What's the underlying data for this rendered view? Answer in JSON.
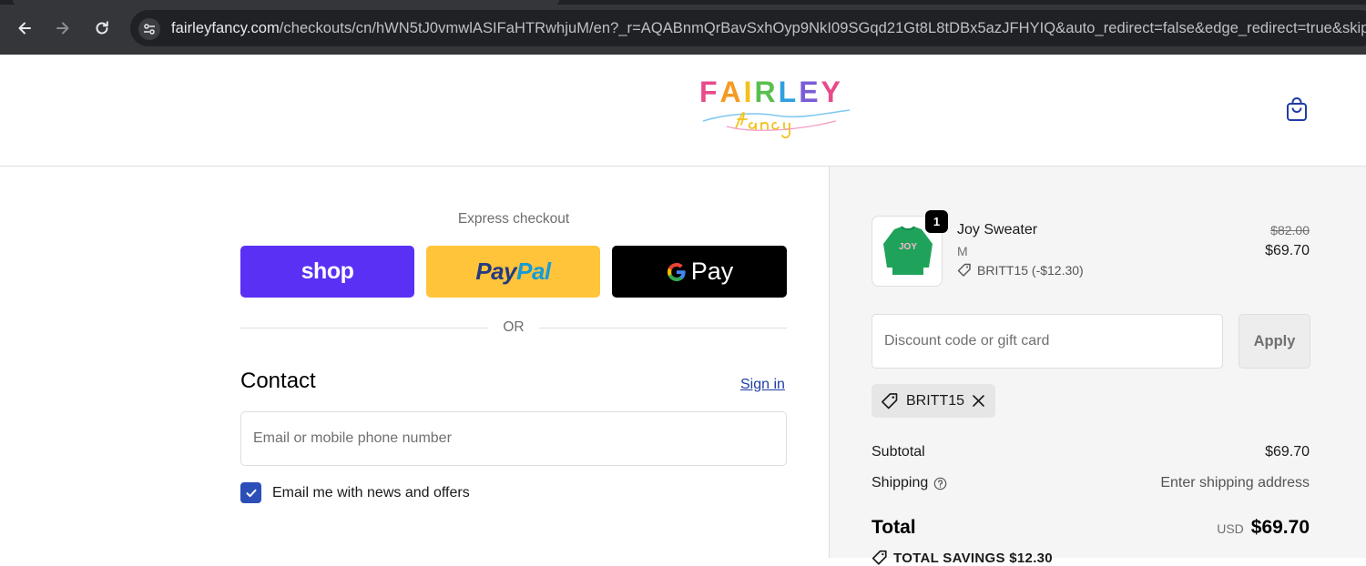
{
  "browser": {
    "url_host": "fairleyfancy.com",
    "url_path": "/checkouts/cn/hWN5tJ0vmwlASIFaHTRwhjuM/en?_r=AQABnmQrBavSxhOyp9NkI09SGqd21Gt8L8tDBx5azJFHYIQ&auto_redirect=false&edge_redirect=true&skip_s"
  },
  "store": {
    "logo_word": "FAIRLEY",
    "logo_script": "fancy",
    "logo_letter_colors": [
      "#e84a8a",
      "#f59a23",
      "#f2c21b",
      "#5bbf4f",
      "#2f9fe0",
      "#7a5cd6",
      "#e84a8a"
    ]
  },
  "express": {
    "label": "Express checkout",
    "shop_label": "shop",
    "paypal_label_1": "Pay",
    "paypal_label_2": "Pal",
    "gpay_label": "Pay"
  },
  "divider": {
    "label": "OR"
  },
  "contact": {
    "title": "Contact",
    "sign_in": "Sign in",
    "email_placeholder": "Email or mobile phone number",
    "news_label": "Email me with news and offers",
    "news_checked": true
  },
  "order": {
    "item": {
      "name": "Joy Sweater",
      "variant": "M",
      "quantity": "1",
      "discount": "BRITT15 (-$12.30)",
      "original_price": "$82.00",
      "price": "$69.70",
      "thumb_text": "JOY"
    },
    "discount_placeholder": "Discount code or gift card",
    "apply_label": "Apply",
    "applied_code": "BRITT15",
    "subtotal_label": "Subtotal",
    "subtotal_value": "$69.70",
    "shipping_label": "Shipping",
    "shipping_value": "Enter shipping address",
    "total_label": "Total",
    "total_currency": "USD",
    "total_value": "$69.70",
    "savings_text": "TOTAL SAVINGS $12.30"
  },
  "colors": {
    "shop_purple": "#5a31f4",
    "paypal_yellow": "#ffc439",
    "link_blue": "#1f3ca5",
    "checkbox_blue": "#2c4eb8"
  }
}
